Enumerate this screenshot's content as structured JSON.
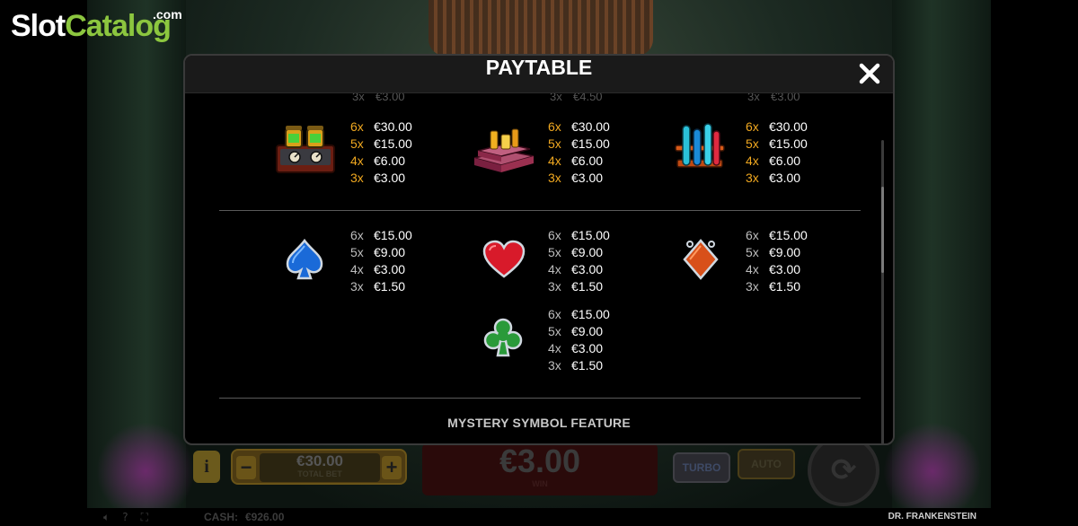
{
  "watermark": {
    "part1": "Slot",
    "part2": "Catalog",
    "suffix": ".com"
  },
  "modal": {
    "title": "PAYTABLE",
    "close_label": "close",
    "cut_row": [
      "3x",
      "€3.00",
      "3x",
      "€4.50",
      "3x",
      "€3.00"
    ],
    "high_symbols": [
      {
        "name": "lab-machine",
        "pays": [
          [
            "6x",
            "€30.00"
          ],
          [
            "5x",
            "€15.00"
          ],
          [
            "4x",
            "€6.00"
          ],
          [
            "3x",
            "€3.00"
          ]
        ]
      },
      {
        "name": "potion-books",
        "pays": [
          [
            "6x",
            "€30.00"
          ],
          [
            "5x",
            "€15.00"
          ],
          [
            "4x",
            "€6.00"
          ],
          [
            "3x",
            "€3.00"
          ]
        ]
      },
      {
        "name": "test-tubes",
        "pays": [
          [
            "6x",
            "€30.00"
          ],
          [
            "5x",
            "€15.00"
          ],
          [
            "4x",
            "€6.00"
          ],
          [
            "3x",
            "€3.00"
          ]
        ]
      }
    ],
    "low_symbols": [
      {
        "name": "spade",
        "pays": [
          [
            "6x",
            "€15.00"
          ],
          [
            "5x",
            "€9.00"
          ],
          [
            "4x",
            "€3.00"
          ],
          [
            "3x",
            "€1.50"
          ]
        ]
      },
      {
        "name": "heart",
        "pays": [
          [
            "6x",
            "€15.00"
          ],
          [
            "5x",
            "€9.00"
          ],
          [
            "4x",
            "€3.00"
          ],
          [
            "3x",
            "€1.50"
          ]
        ]
      },
      {
        "name": "diamond",
        "pays": [
          [
            "6x",
            "€15.00"
          ],
          [
            "5x",
            "€9.00"
          ],
          [
            "4x",
            "€3.00"
          ],
          [
            "3x",
            "€1.50"
          ]
        ]
      },
      {
        "name": "club",
        "pays": [
          [
            "6x",
            "€15.00"
          ],
          [
            "5x",
            "€9.00"
          ],
          [
            "4x",
            "€3.00"
          ],
          [
            "3x",
            "€1.50"
          ]
        ]
      }
    ],
    "next_section": "MYSTERY SYMBOL FEATURE"
  },
  "controls": {
    "info": "i",
    "bet_minus": "−",
    "bet_plus": "+",
    "total_bet_value": "€30.00",
    "total_bet_label": "TOTAL BET",
    "win_value": "€3.00",
    "win_label": "WIN",
    "turbo": "TURBO",
    "auto": "AUTO"
  },
  "status": {
    "cash_label": "CASH:",
    "cash_value": "€926.00",
    "game_name": "DR. FRANKENSTEIN"
  },
  "colors": {
    "multiplier_gold": "#f0a820",
    "logo_green": "#8cc63f"
  }
}
